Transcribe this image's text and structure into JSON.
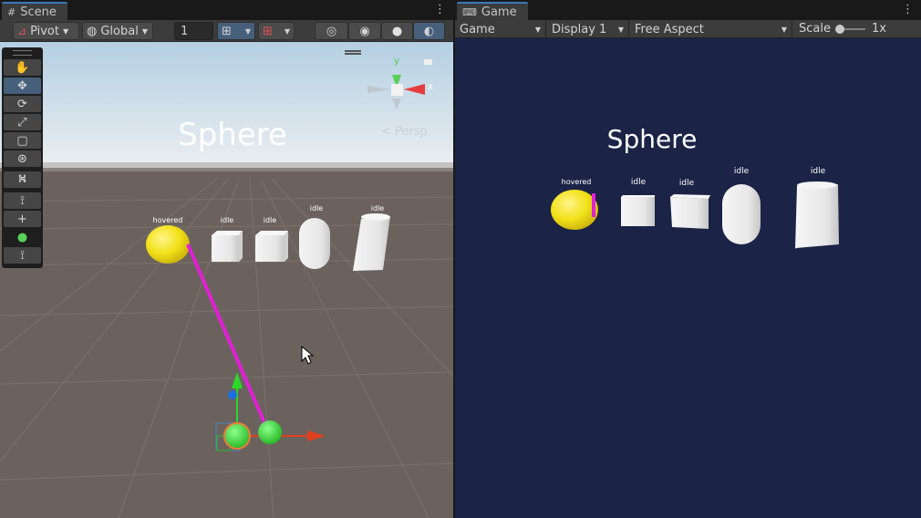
{
  "scene": {
    "tab_title": "Scene",
    "toolbar": {
      "pivot_label": "Pivot",
      "global_label": "Global",
      "grid_value": "1"
    },
    "palette_tools": [
      "hand-tool",
      "move-tool",
      "rotate-tool",
      "scale-tool",
      "rect-tool",
      "transform-tool",
      "custom-tool",
      "path-tool",
      "add-tool",
      "sphere-tool",
      "path-tool-2"
    ],
    "gizmo": {
      "y_axis": "y",
      "x_axis": "x",
      "projection": "< Persp"
    },
    "world_label": "Sphere",
    "object_labels": [
      "hovered",
      "idle",
      "idle",
      "idle",
      "idle"
    ]
  },
  "game": {
    "tab_title": "Game",
    "toolbar": {
      "mode": "Game",
      "display": "Display 1",
      "aspect": "Free Aspect",
      "scale_label": "Scale",
      "scale_value": "1x"
    },
    "world_label": "Sphere",
    "object_labels": [
      "hovered",
      "idle",
      "idle",
      "idle",
      "idle"
    ]
  },
  "colors": {
    "sky_top": "#b4cfe3",
    "ground": "#6b625e",
    "game_bg": "#1b2346",
    "hovered_sphere": "#f2e21a",
    "ray": "#e11fd6",
    "selection_blue": "#46607c"
  }
}
